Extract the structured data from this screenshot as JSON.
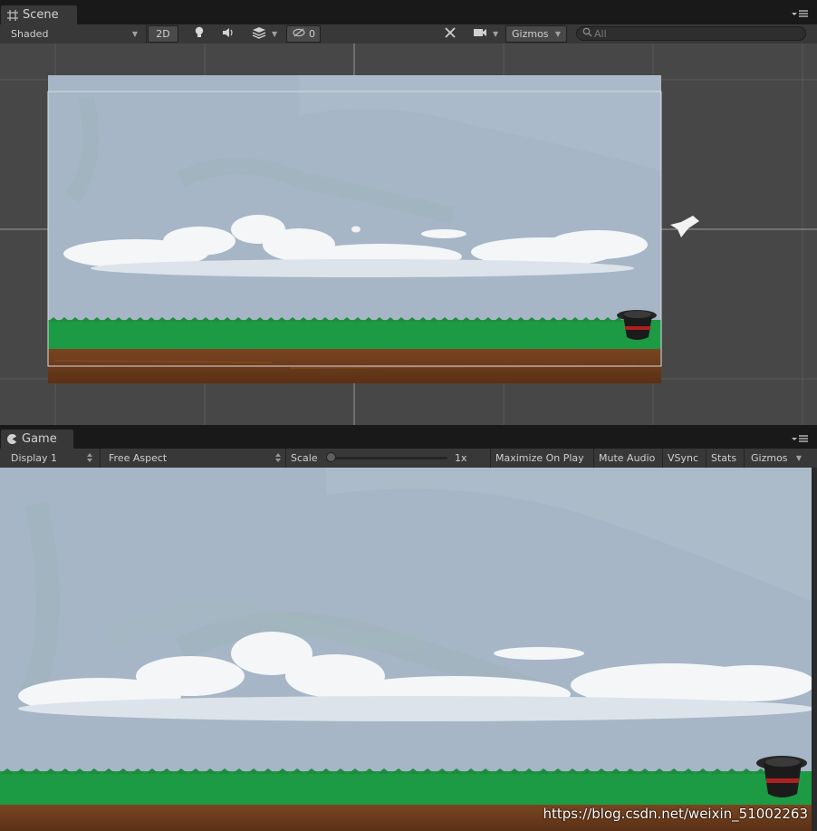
{
  "scene_panel": {
    "tab_label": "Scene",
    "toolbar": {
      "draw_mode": "Shaded",
      "mode_2d": "2D",
      "hidden_count": "0",
      "gizmos_label": "Gizmos",
      "search_placeholder": "All"
    }
  },
  "game_panel": {
    "tab_label": "Game",
    "toolbar": {
      "display": "Display 1",
      "aspect": "Free Aspect",
      "scale_label": "Scale",
      "scale_value": "1x",
      "maximize_label": "Maximize On Play",
      "mute_label": "Mute Audio",
      "vsync_label": "VSync",
      "stats_label": "Stats",
      "gizmos_label": "Gizmos"
    }
  },
  "watermark": "https://blog.csdn.net/weixin_51002263",
  "colors": {
    "sky": "#a6b6c6",
    "grass": "#1d9a44",
    "dirt": "#6a3c1c",
    "scene_bg": "#474747"
  }
}
